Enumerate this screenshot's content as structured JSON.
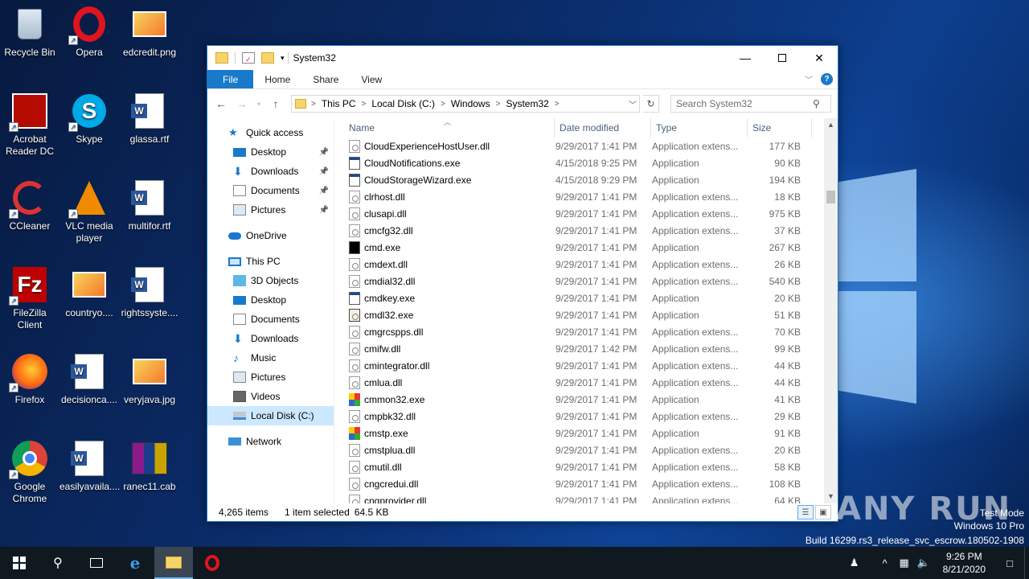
{
  "desktop": {
    "icons": [
      {
        "label": "Recycle Bin",
        "icon": "recycle-bin-icon"
      },
      {
        "label": "Opera",
        "icon": "opera-icon"
      },
      {
        "label": "edcredit.png",
        "icon": "image-file-icon"
      },
      {
        "label": "Acrobat Reader DC",
        "icon": "acrobat-icon"
      },
      {
        "label": "Skype",
        "icon": "skype-icon"
      },
      {
        "label": "glassa.rtf",
        "icon": "word-doc-icon"
      },
      {
        "label": "CCleaner",
        "icon": "ccleaner-icon"
      },
      {
        "label": "VLC media player",
        "icon": "vlc-icon"
      },
      {
        "label": "multifor.rtf",
        "icon": "word-doc-icon"
      },
      {
        "label": "FileZilla Client",
        "icon": "filezilla-icon"
      },
      {
        "label": "countryo....",
        "icon": "image-file-icon"
      },
      {
        "label": "rightssyste....",
        "icon": "word-doc-icon"
      },
      {
        "label": "Firefox",
        "icon": "firefox-icon"
      },
      {
        "label": "decisionca....",
        "icon": "word-doc-icon"
      },
      {
        "label": "veryjava.jpg",
        "icon": "image-file-icon"
      },
      {
        "label": "Google Chrome",
        "icon": "chrome-icon"
      },
      {
        "label": "easilyavaila....",
        "icon": "word-doc-icon"
      },
      {
        "label": "ranec11.cab",
        "icon": "winrar-icon"
      }
    ]
  },
  "explorer": {
    "title": "System32",
    "ribbon": {
      "file": "File",
      "home": "Home",
      "share": "Share",
      "view": "View"
    },
    "address": [
      "This PC",
      "Local Disk (C:)",
      "Windows",
      "System32"
    ],
    "search_placeholder": "Search System32",
    "nav": {
      "quick_access": "Quick access",
      "qa_items": [
        "Desktop",
        "Downloads",
        "Documents",
        "Pictures"
      ],
      "onedrive": "OneDrive",
      "this_pc": "This PC",
      "pc_items": [
        "3D Objects",
        "Desktop",
        "Documents",
        "Downloads",
        "Music",
        "Pictures",
        "Videos",
        "Local Disk (C:)"
      ],
      "network": "Network"
    },
    "columns": {
      "name": "Name",
      "date": "Date modified",
      "type": "Type",
      "size": "Size"
    },
    "files": [
      {
        "name": "CloudExperienceHostUser.dll",
        "date": "9/29/2017 1:41 PM",
        "type": "Application extens...",
        "size": "177 KB",
        "icon": "dll"
      },
      {
        "name": "CloudNotifications.exe",
        "date": "4/15/2018 9:25 PM",
        "type": "Application",
        "size": "90 KB",
        "icon": "app"
      },
      {
        "name": "CloudStorageWizard.exe",
        "date": "4/15/2018 9:29 PM",
        "type": "Application",
        "size": "194 KB",
        "icon": "app"
      },
      {
        "name": "clrhost.dll",
        "date": "9/29/2017 1:41 PM",
        "type": "Application extens...",
        "size": "18 KB",
        "icon": "dll"
      },
      {
        "name": "clusapi.dll",
        "date": "9/29/2017 1:41 PM",
        "type": "Application extens...",
        "size": "975 KB",
        "icon": "dll"
      },
      {
        "name": "cmcfg32.dll",
        "date": "9/29/2017 1:41 PM",
        "type": "Application extens...",
        "size": "37 KB",
        "icon": "dll"
      },
      {
        "name": "cmd.exe",
        "date": "9/29/2017 1:41 PM",
        "type": "Application",
        "size": "267 KB",
        "icon": "cmd"
      },
      {
        "name": "cmdext.dll",
        "date": "9/29/2017 1:41 PM",
        "type": "Application extens...",
        "size": "26 KB",
        "icon": "dll"
      },
      {
        "name": "cmdial32.dll",
        "date": "9/29/2017 1:41 PM",
        "type": "Application extens...",
        "size": "540 KB",
        "icon": "dll"
      },
      {
        "name": "cmdkey.exe",
        "date": "9/29/2017 1:41 PM",
        "type": "Application",
        "size": "20 KB",
        "icon": "app"
      },
      {
        "name": "cmdl32.exe",
        "date": "9/29/2017 1:41 PM",
        "type": "Application",
        "size": "51 KB",
        "icon": "dl32"
      },
      {
        "name": "cmgrcspps.dll",
        "date": "9/29/2017 1:41 PM",
        "type": "Application extens...",
        "size": "70 KB",
        "icon": "dll"
      },
      {
        "name": "cmifw.dll",
        "date": "9/29/2017 1:42 PM",
        "type": "Application extens...",
        "size": "99 KB",
        "icon": "dll"
      },
      {
        "name": "cmintegrator.dll",
        "date": "9/29/2017 1:41 PM",
        "type": "Application extens...",
        "size": "44 KB",
        "icon": "dll"
      },
      {
        "name": "cmlua.dll",
        "date": "9/29/2017 1:41 PM",
        "type": "Application extens...",
        "size": "44 KB",
        "icon": "dll"
      },
      {
        "name": "cmmon32.exe",
        "date": "9/29/2017 1:41 PM",
        "type": "Application",
        "size": "41 KB",
        "icon": "color"
      },
      {
        "name": "cmpbk32.dll",
        "date": "9/29/2017 1:41 PM",
        "type": "Application extens...",
        "size": "29 KB",
        "icon": "dll"
      },
      {
        "name": "cmstp.exe",
        "date": "9/29/2017 1:41 PM",
        "type": "Application",
        "size": "91 KB",
        "icon": "color"
      },
      {
        "name": "cmstplua.dll",
        "date": "9/29/2017 1:41 PM",
        "type": "Application extens...",
        "size": "20 KB",
        "icon": "dll"
      },
      {
        "name": "cmutil.dll",
        "date": "9/29/2017 1:41 PM",
        "type": "Application extens...",
        "size": "58 KB",
        "icon": "dll"
      },
      {
        "name": "cngcredui.dll",
        "date": "9/29/2017 1:41 PM",
        "type": "Application extens...",
        "size": "108 KB",
        "icon": "dll"
      },
      {
        "name": "cngprovider.dll",
        "date": "9/29/2017 1:41 PM",
        "type": "Application extens...",
        "size": "64 KB",
        "icon": "dll"
      }
    ],
    "status": {
      "count": "4,265 items",
      "selected": "1 item selected",
      "selsize": "64.5 KB"
    }
  },
  "watermark": {
    "brand": "ANY RUN",
    "line1": "Test Mode",
    "line2": "Windows 10 Pro",
    "line3": "Build 16299.rs3_release_svc_escrow.180502-1908"
  },
  "taskbar": {
    "time": "9:26 PM",
    "date": "8/21/2020"
  },
  "colors": {
    "accent": "#1979ca",
    "selection": "#cce8ff",
    "taskbar": "#101820"
  }
}
